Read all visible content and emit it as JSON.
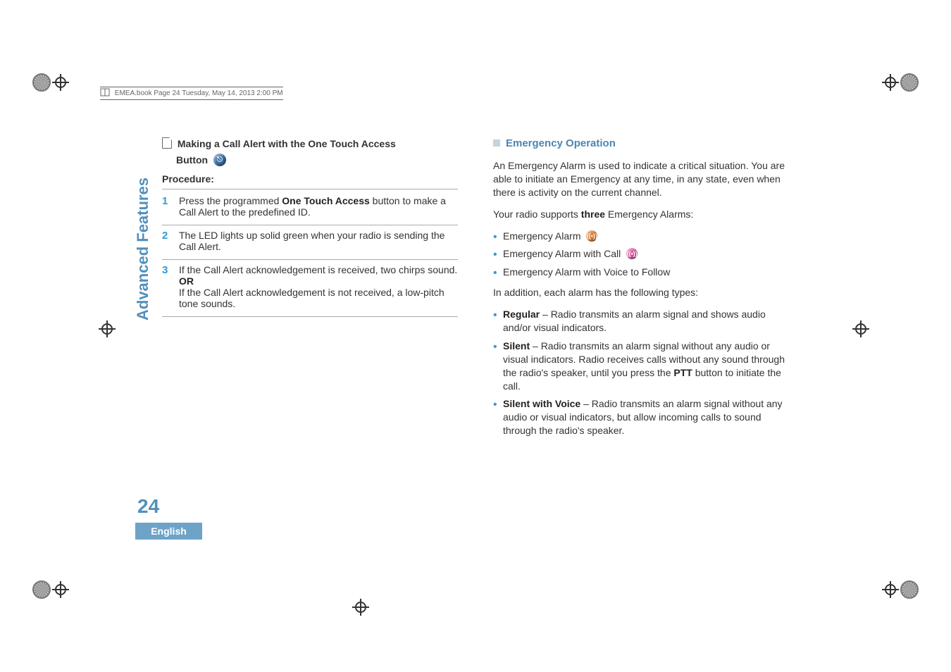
{
  "book_header": "EMEA.book  Page 24  Tuesday, May 14, 2013  2:00 PM",
  "side_tab": "Advanced Features",
  "page_number": "24",
  "language": "English",
  "left": {
    "heading_pre": "Making a Call Alert with the One Touch Access",
    "heading_post": "Button",
    "procedure_label": "Procedure:",
    "steps": [
      {
        "n": "1",
        "pre": "Press the programmed ",
        "bold": "One Touch Access",
        "post": " button to make a Call Alert to the predefined ID."
      },
      {
        "n": "2",
        "text": "The LED lights up solid green when your radio is sending the Call Alert."
      },
      {
        "n": "3",
        "text1": "If the Call Alert acknowledgement is received, two chirps sound.",
        "or": "OR",
        "text2": "If the Call Alert acknowledgement is not received, a low-pitch tone sounds."
      }
    ]
  },
  "right": {
    "heading": "Emergency Operation",
    "p1": "An Emergency Alarm is used to indicate a critical situation. You are able to initiate an Emergency at any time, in any state, even when there is activity on the current channel.",
    "p2_pre": "Your radio supports ",
    "p2_bold": "three",
    "p2_post": " Emergency Alarms:",
    "alarms": [
      "Emergency Alarm",
      "Emergency Alarm with Call",
      "Emergency Alarm with Voice to Follow"
    ],
    "p3": "In addition, each alarm has the following types:",
    "types": [
      {
        "name": "Regular",
        "desc": " – Radio transmits an alarm signal and shows audio and/or visual indicators."
      },
      {
        "name": "Silent",
        "desc_pre": " – Radio transmits an alarm signal without any audio or visual indicators. Radio receives calls without any sound through the radio's speaker, until you press the ",
        "desc_bold": "PTT",
        "desc_post": " button to initiate the call."
      },
      {
        "name": "Silent with Voice",
        "desc": " – Radio transmits an alarm signal without any audio or visual indicators, but allow incoming calls to sound through the radio's speaker."
      }
    ]
  }
}
